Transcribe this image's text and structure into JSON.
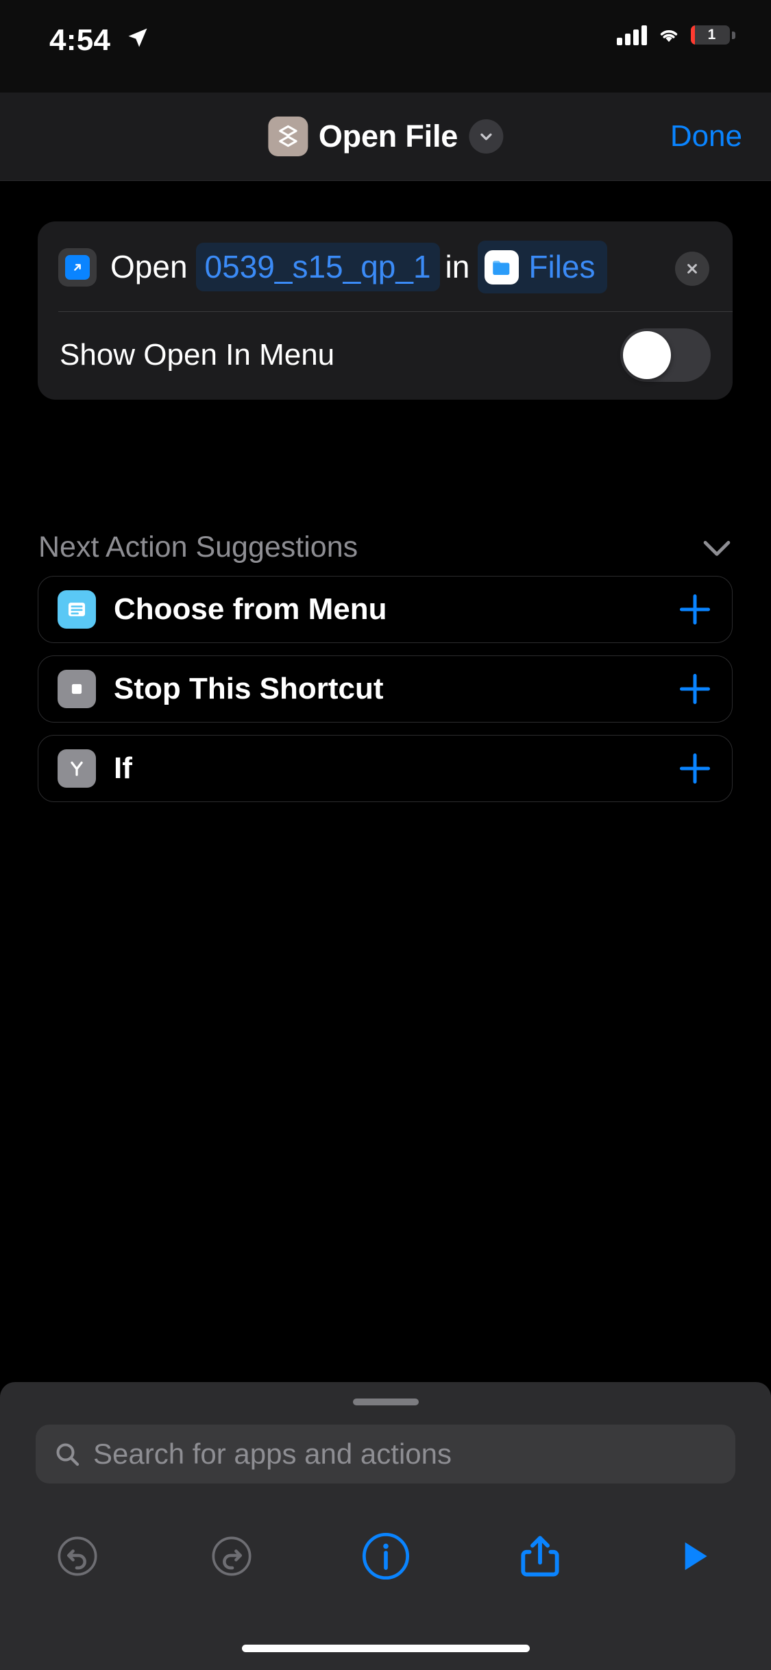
{
  "status_bar": {
    "time": "4:54",
    "location_icon": "location-arrow-icon",
    "cellular_icon": "cellular-signal-icon",
    "wifi_icon": "wifi-icon",
    "battery_percent": "1",
    "battery_state_color": "#ff3b30"
  },
  "nav_bar": {
    "app_icon": "shortcuts-layers-icon",
    "title": "Open File",
    "chevron_icon": "chevron-down-icon",
    "done_label": "Done",
    "accent_color": "#0a84ff"
  },
  "action": {
    "icon": "open-in-arrow-icon",
    "verb": "Open",
    "file_token": "0539_s15_qp_1",
    "connector": "in",
    "app_token": "Files",
    "app_icon": "files-folder-icon",
    "remove_icon": "close-x-icon",
    "toggle_label": "Show Open In Menu",
    "toggle_on": false,
    "token_color": "#3b8bf7"
  },
  "suggestions": {
    "header": "Next Action Suggestions",
    "collapse_icon": "chevron-down-icon",
    "items": [
      {
        "label": "Choose from Menu",
        "icon": "menu-list-icon",
        "icon_color": "#5ac8f5",
        "add_icon": "plus-icon"
      },
      {
        "label": "Stop This Shortcut",
        "icon": "stop-square-icon",
        "icon_color": "#8e8e93",
        "add_icon": "plus-icon"
      },
      {
        "label": "If",
        "icon": "branch-if-icon",
        "icon_color": "#8e8e93",
        "add_icon": "plus-icon"
      }
    ]
  },
  "sheet": {
    "grabber": "drag-handle",
    "search_placeholder": "Search for apps and actions",
    "search_icon": "search-icon",
    "search_value": ""
  },
  "toolbar": {
    "items": [
      {
        "name": "undo-icon",
        "enabled": false
      },
      {
        "name": "redo-icon",
        "enabled": false
      },
      {
        "name": "info-icon",
        "enabled": true
      },
      {
        "name": "share-icon",
        "enabled": true
      },
      {
        "name": "play-icon",
        "enabled": true
      }
    ],
    "disabled_color": "#6e6e73",
    "enabled_color": "#0a84ff"
  }
}
